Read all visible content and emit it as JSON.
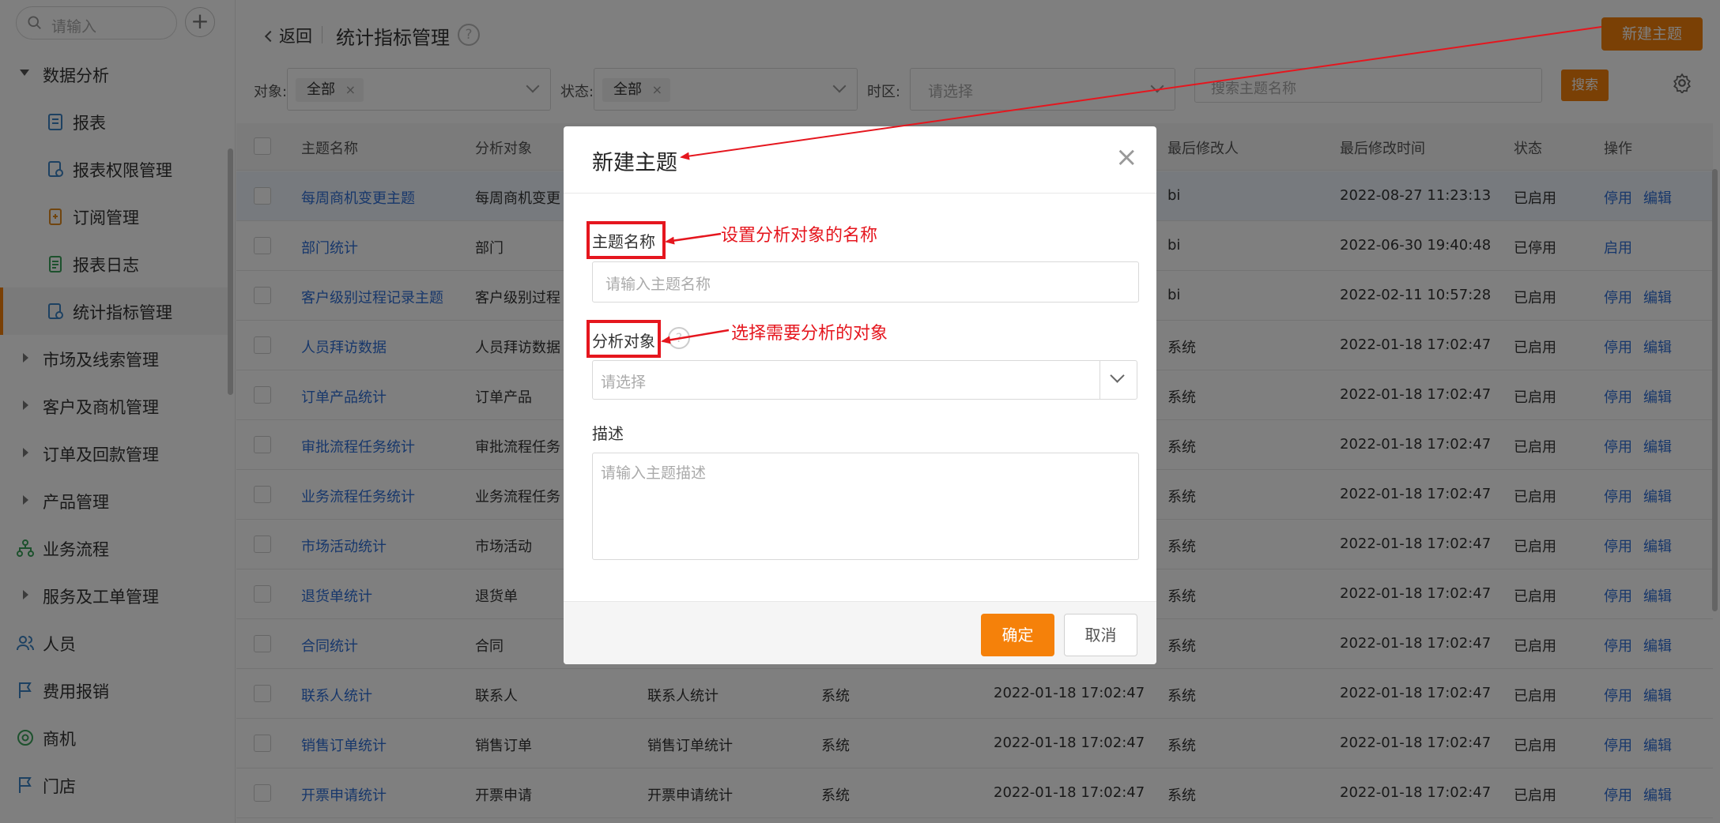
{
  "sidebar": {
    "search_placeholder": "请输入",
    "add_label": "+",
    "items": [
      {
        "label": "数据分析"
      },
      {
        "label": "报表"
      },
      {
        "label": "报表权限管理"
      },
      {
        "label": "订阅管理"
      },
      {
        "label": "报表日志"
      },
      {
        "label": "统计指标管理"
      },
      {
        "label": "市场及线索管理"
      },
      {
        "label": "客户及商机管理"
      },
      {
        "label": "订单及回款管理"
      },
      {
        "label": "产品管理"
      },
      {
        "label": "业务流程"
      },
      {
        "label": "服务及工单管理"
      },
      {
        "label": "人员"
      },
      {
        "label": "费用报销"
      },
      {
        "label": "商机"
      },
      {
        "label": "门店"
      }
    ]
  },
  "header": {
    "back_label": "返回",
    "title": "统计指标管理",
    "help": "?",
    "new_button": "新建主题"
  },
  "filters": {
    "object_label": "对象:",
    "object_tag": "全部",
    "status_label": "状态:",
    "status_tag": "全部",
    "tag_close": "×",
    "timezone_label": "时区:",
    "timezone_placeholder": "请选择",
    "search_placeholder": "搜索主题名称",
    "search_button": "搜索"
  },
  "table": {
    "columns": [
      "主题名称",
      "分析对象",
      "最后修改人",
      "最后修改时间",
      "状态",
      "操作"
    ],
    "rows": [
      {
        "name": "每周商机变更主题",
        "object": "每周商机变更",
        "c3": "",
        "c4": "",
        "c5": "",
        "modifier": "bi",
        "time": "2022-08-27 11:23:13",
        "status": "已启用",
        "a1": "停用",
        "a2": "编辑"
      },
      {
        "name": "部门统计",
        "object": "部门",
        "c3": "",
        "c4": "",
        "c5": "",
        "modifier": "bi",
        "time": "2022-06-30 19:40:48",
        "status": "已停用",
        "a1": "启用",
        "a2": ""
      },
      {
        "name": "客户级别过程记录主题",
        "object": "客户级别过程",
        "c3": "",
        "c4": "",
        "c5": "",
        "modifier": "bi",
        "time": "2022-02-11 10:57:28",
        "status": "已启用",
        "a1": "停用",
        "a2": "编辑"
      },
      {
        "name": "人员拜访数据",
        "object": "人员拜访数据",
        "c3": "",
        "c4": "",
        "c5": "",
        "modifier": "系统",
        "time": "2022-01-18 17:02:47",
        "status": "已启用",
        "a1": "停用",
        "a2": "编辑"
      },
      {
        "name": "订单产品统计",
        "object": "订单产品",
        "c3": "",
        "c4": "",
        "c5": "",
        "modifier": "系统",
        "time": "2022-01-18 17:02:47",
        "status": "已启用",
        "a1": "停用",
        "a2": "编辑"
      },
      {
        "name": "审批流程任务统计",
        "object": "审批流程任务",
        "c3": "",
        "c4": "",
        "c5": "",
        "modifier": "系统",
        "time": "2022-01-18 17:02:47",
        "status": "已启用",
        "a1": "停用",
        "a2": "编辑"
      },
      {
        "name": "业务流程任务统计",
        "object": "业务流程任务",
        "c3": "",
        "c4": "",
        "c5": "",
        "modifier": "系统",
        "time": "2022-01-18 17:02:47",
        "status": "已启用",
        "a1": "停用",
        "a2": "编辑"
      },
      {
        "name": "市场活动统计",
        "object": "市场活动",
        "c3": "",
        "c4": "",
        "c5": "",
        "modifier": "系统",
        "time": "2022-01-18 17:02:47",
        "status": "已启用",
        "a1": "停用",
        "a2": "编辑"
      },
      {
        "name": "退货单统计",
        "object": "退货单",
        "c3": "",
        "c4": "",
        "c5": "",
        "modifier": "系统",
        "time": "2022-01-18 17:02:47",
        "status": "已启用",
        "a1": "停用",
        "a2": "编辑"
      },
      {
        "name": "合同统计",
        "object": "合同",
        "c3": "",
        "c4": "",
        "c5": "",
        "modifier": "系统",
        "time": "2022-01-18 17:02:47",
        "status": "已启用",
        "a1": "停用",
        "a2": "编辑"
      },
      {
        "name": "联系人统计",
        "object": "联系人",
        "c3": "联系人统计",
        "c4": "系统",
        "c5": "2022-01-18 17:02:47",
        "modifier": "系统",
        "time": "2022-01-18 17:02:47",
        "status": "已启用",
        "a1": "停用",
        "a2": "编辑"
      },
      {
        "name": "销售订单统计",
        "object": "销售订单",
        "c3": "销售订单统计",
        "c4": "系统",
        "c5": "2022-01-18 17:02:47",
        "modifier": "系统",
        "time": "2022-01-18 17:02:47",
        "status": "已启用",
        "a1": "停用",
        "a2": "编辑"
      },
      {
        "name": "开票申请统计",
        "object": "开票申请",
        "c3": "开票申请统计",
        "c4": "系统",
        "c5": "2022-01-18 17:02:47",
        "modifier": "系统",
        "time": "2022-01-18 17:02:47",
        "status": "已启用",
        "a1": "停用",
        "a2": "编辑"
      }
    ]
  },
  "modal": {
    "title": "新建主题",
    "close": "×",
    "name_label": "主题名称",
    "name_placeholder": "请输入主题名称",
    "object_label": "分析对象",
    "object_help": "?",
    "object_placeholder": "请选择",
    "desc_label": "描述",
    "desc_placeholder": "请输入主题描述",
    "ok_button": "确定",
    "cancel_button": "取消"
  },
  "annotations": {
    "name_note": "设置分析对象的名称",
    "object_note": "选择需要分析的对象",
    "color": "#e5161e"
  }
}
